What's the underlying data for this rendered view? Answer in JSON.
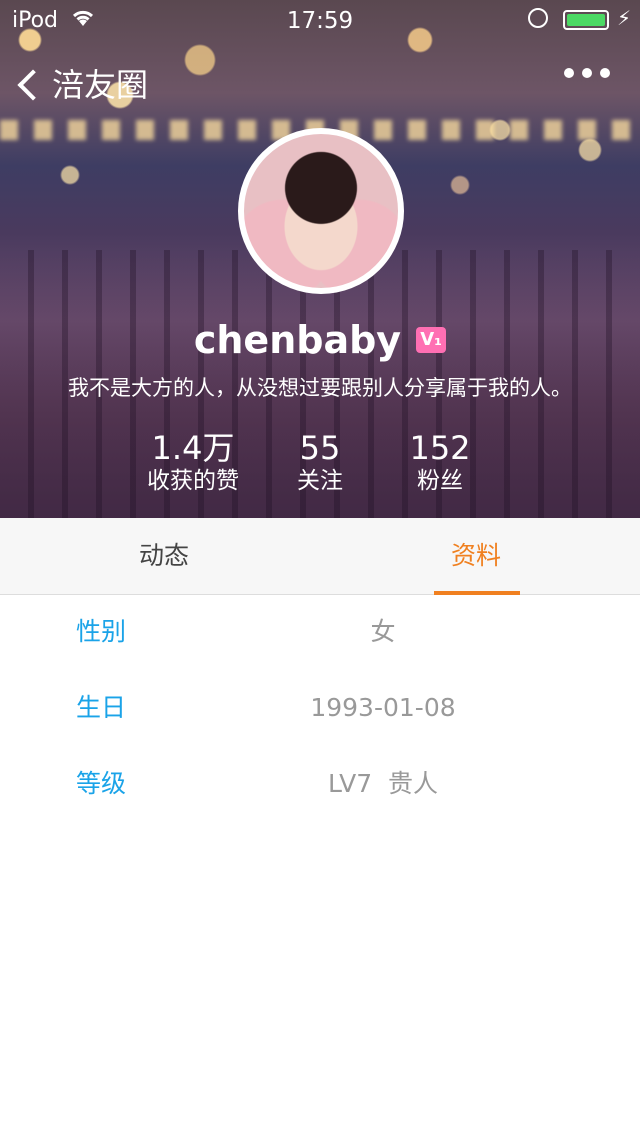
{
  "status_bar": {
    "carrier": "iPod",
    "time": "17:59",
    "battery_level": 1.0
  },
  "nav": {
    "back_label": "涪友圈"
  },
  "profile": {
    "username": "chenbaby",
    "badge": "V₁",
    "bio": "我不是大方的人，从没想过要跟别人分享属于我的人。"
  },
  "stats": [
    {
      "value": "1.4万",
      "label": "收获的赞"
    },
    {
      "value": "55",
      "label": "关注"
    },
    {
      "value": "152",
      "label": "粉丝"
    }
  ],
  "tabs": [
    {
      "label": "动态",
      "active": false
    },
    {
      "label": "资料",
      "active": true
    }
  ],
  "info": [
    {
      "key": "性别",
      "value": "女"
    },
    {
      "key": "生日",
      "value": "1993-01-08"
    },
    {
      "key": "等级",
      "value": "LV7  贵人"
    }
  ],
  "colors": {
    "accent_orange": "#f08020",
    "key_blue": "#1aa3e8",
    "value_gray": "#999999",
    "battery_green": "#4cd964"
  }
}
